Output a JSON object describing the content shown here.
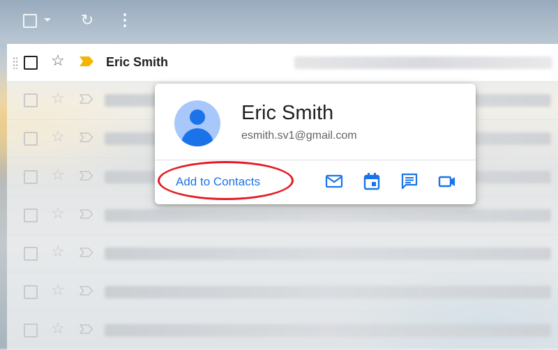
{
  "email_list": {
    "first_row": {
      "sender": "Eric Smith"
    }
  },
  "contact_card": {
    "name": "Eric Smith",
    "email": "esmith.sv1@gmail.com",
    "add_to_contacts_label": "Add to Contacts",
    "actions": [
      "mail-icon",
      "calendar-icon",
      "chat-icon",
      "video-call-icon"
    ]
  },
  "colors": {
    "accent": "#1a73e8",
    "highlight_oval": "#e41b23",
    "important_marker": "#f4b400"
  }
}
